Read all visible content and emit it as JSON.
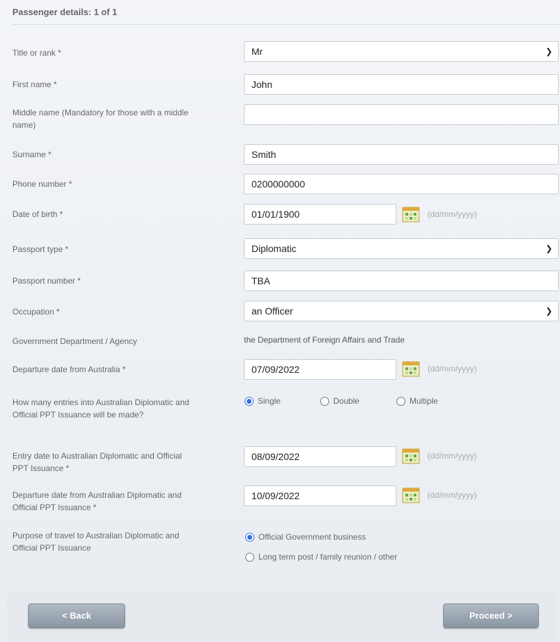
{
  "header": {
    "title": "Passenger details: 1 of 1"
  },
  "fields": {
    "title": {
      "label": "Title or rank",
      "value": "Mr"
    },
    "first_name": {
      "label": "First name",
      "value": "John"
    },
    "middle_name": {
      "label": "Middle name (Mandatory for those with a middle name)",
      "value": ""
    },
    "surname": {
      "label": "Surname",
      "value": "Smith"
    },
    "phone": {
      "label": "Phone number",
      "value": "0200000000"
    },
    "dob": {
      "label": "Date of birth",
      "value": "01/01/1900"
    },
    "passport_type": {
      "label": "Passport type",
      "value": "Diplomatic"
    },
    "passport_number": {
      "label": "Passport number",
      "value": "TBA"
    },
    "occupation": {
      "label": "Occupation",
      "value": "an Officer"
    },
    "government": {
      "label": "Government Department / Agency",
      "value": "the Department of Foreign Affairs and Trade"
    },
    "departure_aus": {
      "label": "Departure date from Australia",
      "value": "07/09/2022"
    },
    "entries": {
      "label": "How many entries into Australian Diplomatic and Official PPT Issuance will be made?",
      "options": [
        "Single",
        "Double",
        "Multiple"
      ],
      "selected": "Single"
    },
    "entry_date": {
      "label": "Entry date to Australian Diplomatic and Official PPT Issuance",
      "value": "08/09/2022"
    },
    "departure_date": {
      "label": "Departure date from Australian Diplomatic and Official PPT Issuance",
      "value": "10/09/2022"
    },
    "purpose": {
      "label": "Purpose of travel to Australian Diplomatic and Official PPT Issuance",
      "options": [
        "Official Government business",
        "Long term post / family reunion / other"
      ],
      "selected": "Official Government business"
    }
  },
  "required_marker": "*",
  "date_format_hint": "(dd/mm/yyyy)",
  "select_chevron": "chevron-down-icon",
  "calendar_icon": "calendar-icon",
  "buttons": {
    "back": "< Back",
    "proceed": "Proceed >"
  },
  "colors": {
    "accent": "#2f6fe0",
    "button": "#98a3ae"
  }
}
